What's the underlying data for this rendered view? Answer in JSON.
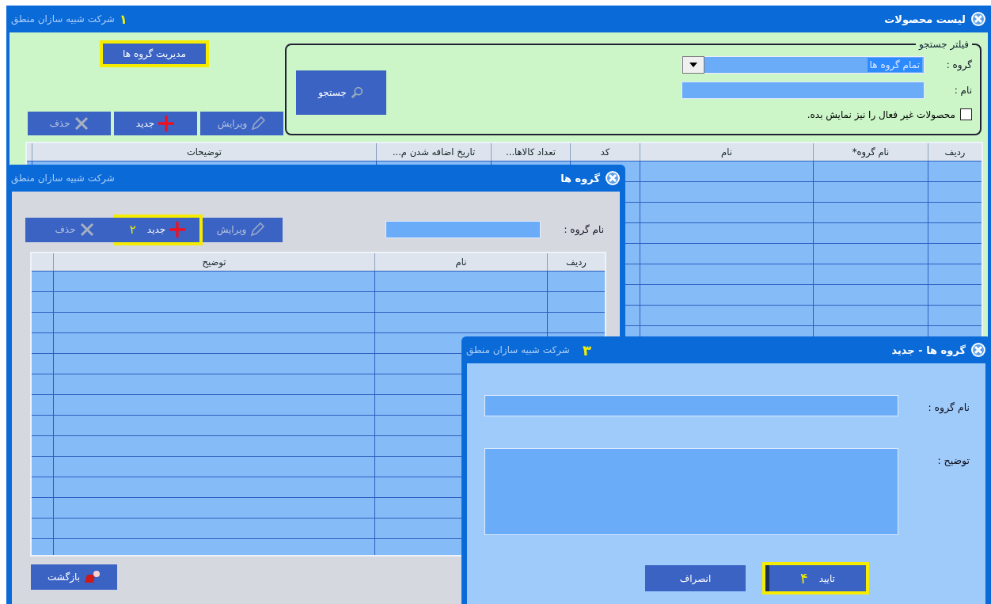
{
  "main_window": {
    "title": "لیست محصولات",
    "company": "شرکت شبیه سازان منطق",
    "annotation": "۱",
    "filter": {
      "legend": "فیلتر جستجو",
      "group_label": "گروه :",
      "group_value": "تمام گروه ها",
      "name_label": "نام :",
      "inactive_checkbox": {
        "label": "محصولات غیر فعال را نیز نمایش بده.",
        "checked": false
      }
    },
    "search_button": "جستجو",
    "manage_groups_button": {
      "label": "مدیریت گروه ها",
      "highlighted": true
    },
    "toolbar": [
      {
        "kind": "edit",
        "label": "ویرایش",
        "disabled": true,
        "highlighted": false
      },
      {
        "kind": "new",
        "label": "جدید",
        "disabled": false,
        "highlighted": false
      },
      {
        "kind": "delete",
        "label": "حذف",
        "disabled": true,
        "highlighted": false
      }
    ],
    "table": {
      "columns": [
        "ردیف",
        "نام گروه*",
        "نام",
        "کد",
        "تعداد کالاها...",
        "تاریخ اضافه شدن م...",
        "توضیحات"
      ]
    }
  },
  "groups_window": {
    "title": "گروه ها",
    "company": "شرکت شبیه سازان منطق",
    "group_name_label": "نام گروه :",
    "toolbar": [
      {
        "kind": "edit",
        "label": "ویرایش",
        "disabled": true,
        "highlighted": false
      },
      {
        "kind": "new",
        "label": "جدید",
        "disabled": false,
        "highlighted": true,
        "annotation": "۲"
      },
      {
        "kind": "delete",
        "label": "حذف",
        "disabled": true,
        "highlighted": false
      }
    ],
    "table": {
      "columns": [
        "ردیف",
        "نام",
        "توضیح"
      ]
    },
    "back_button": "بازگشت"
  },
  "new_group_window": {
    "title": "گروه ها - جدید",
    "company": "شرکت شبیه سازان منطق",
    "annotation": "۳",
    "group_name_label": "نام گروه :",
    "description_label": "توضیح :",
    "buttons": [
      {
        "kind": "confirm",
        "label": "تایید",
        "highlighted": true,
        "annotation": "۴"
      },
      {
        "kind": "cancel",
        "label": "انصراف",
        "highlighted": false
      }
    ]
  }
}
